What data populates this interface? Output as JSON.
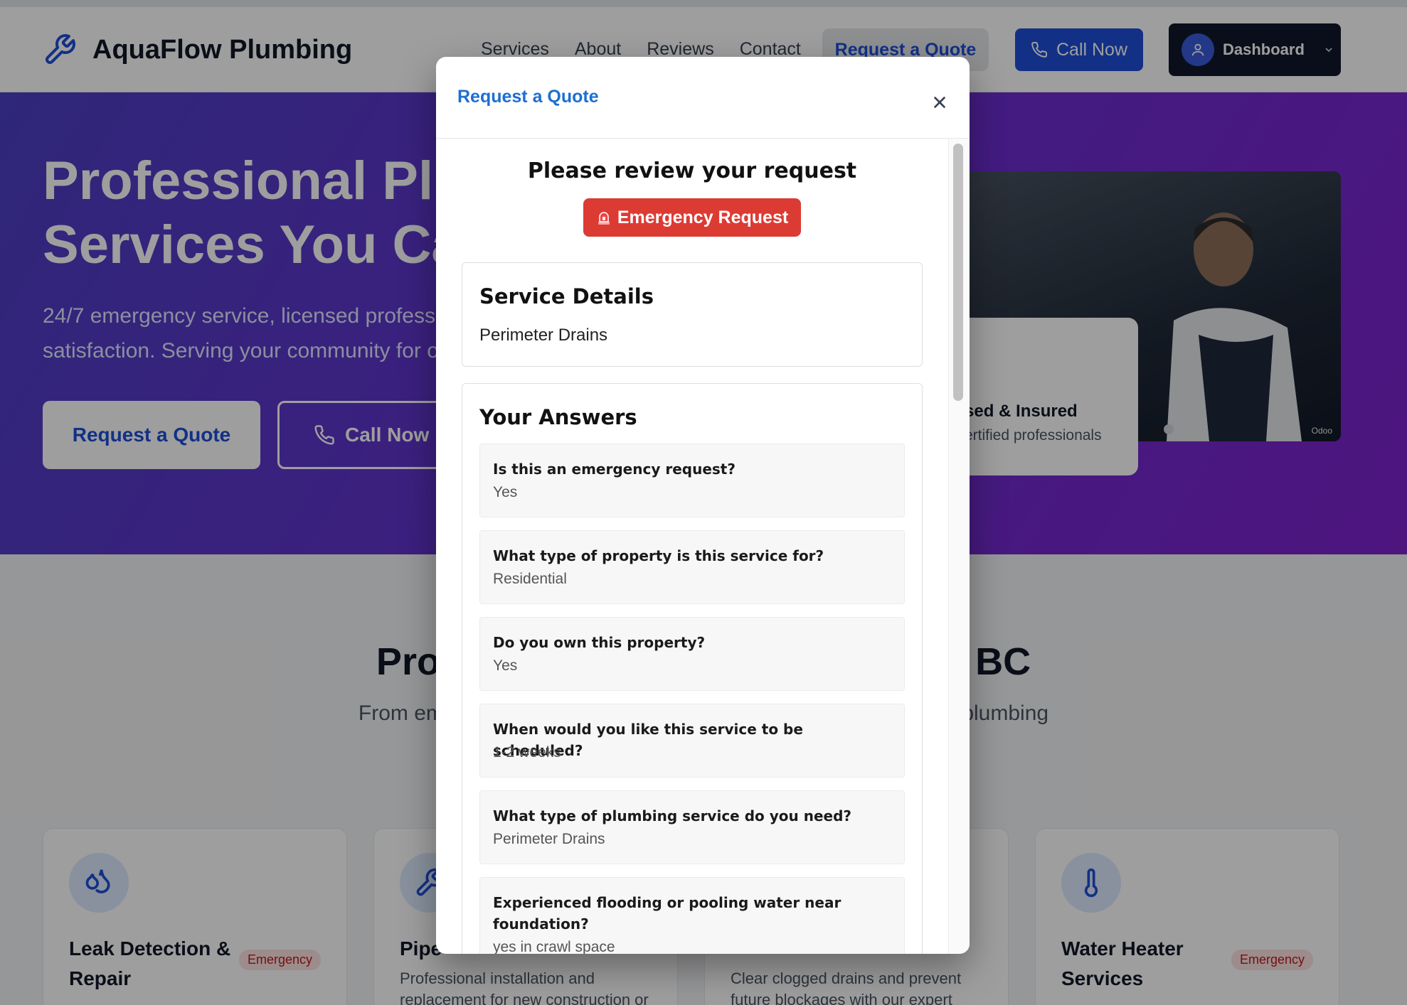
{
  "header": {
    "brand": "AquaFlow Plumbing",
    "nav": [
      "Services",
      "About",
      "Reviews",
      "Contact"
    ],
    "quote_button": "Request a Quote",
    "call_button": "Call Now",
    "dashboard_button": "Dashboard"
  },
  "hero": {
    "title_line1": "Professional Plur",
    "title_line2": "Services You Car",
    "subtitle_line1": "24/7 emergency service, licensed professi",
    "subtitle_line2": "satisfaction. Serving your community for o",
    "quote_button": "Request a Quote",
    "call_button": "Call Now",
    "badge_title": "sed & Insured",
    "badge_subtitle": "ertified professionals",
    "image_watermark": "Odoo"
  },
  "section": {
    "title_left": "Professi",
    "title_right": "oria, BC",
    "subtitle_left": "From emergency",
    "subtitle_right": "sive plumbing"
  },
  "cards": [
    {
      "title": "Leak Detection & Repair",
      "badge": "Emergency",
      "desc": ""
    },
    {
      "title": "Pipe",
      "badge": "",
      "desc": "Professional installation and replacement for new construction or"
    },
    {
      "title": "",
      "badge": "",
      "desc": "Clear clogged drains and prevent future blockages with our expert"
    },
    {
      "title": "Water Heater Services",
      "badge": "Emergency",
      "desc": ""
    }
  ],
  "modal": {
    "title": "Request a Quote",
    "review_heading": "Please review your request",
    "emergency_label": "Emergency Request",
    "emergency_icon": "siren-icon",
    "service_details_heading": "Service Details",
    "service_details_value": "Perimeter Drains",
    "answers_heading": "Your Answers",
    "answers": [
      {
        "q": "Is this an emergency request?",
        "a": "Yes"
      },
      {
        "q": "What type of property is this service for?",
        "a": "Residential"
      },
      {
        "q": "Do you own this property?",
        "a": "Yes"
      },
      {
        "q": "When would you like this service to be scheduled?",
        "a": "1-2 weeks"
      },
      {
        "q": "What type of plumbing service do you need?",
        "a": "Perimeter Drains"
      },
      {
        "q": "Experienced flooding or pooling water near foundation?",
        "a": "yes in crawl space"
      }
    ]
  },
  "colors": {
    "primary": "#1d4ed8",
    "modal_title": "#1d6fd1",
    "emergency": "#dc3b34",
    "hero_gradient_start": "#4c3fc5",
    "hero_gradient_end": "#7e22ce"
  }
}
